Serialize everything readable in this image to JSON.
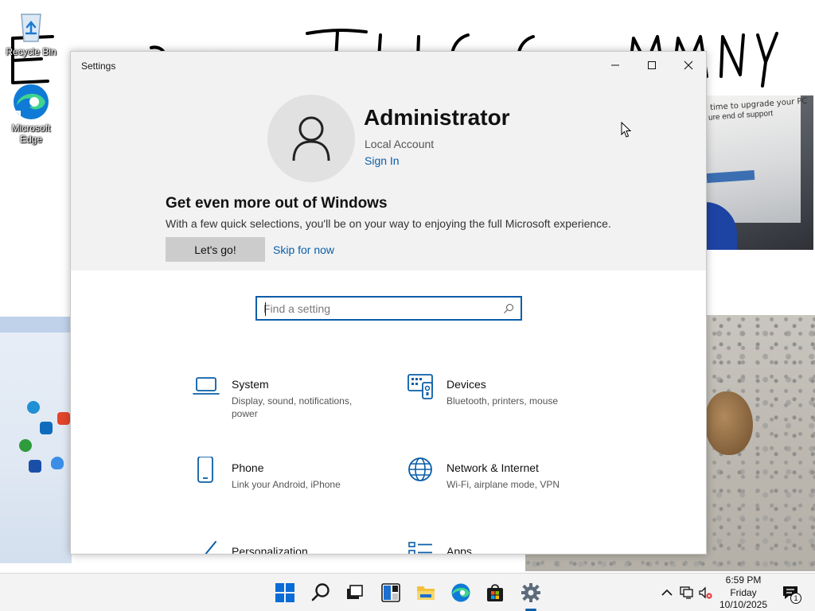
{
  "desktop": {
    "icons": [
      {
        "label": "Recycle Bin",
        "icon": "recycle-bin-icon"
      },
      {
        "label": "Microsoft Edge",
        "icon": "edge-icon"
      }
    ],
    "monitor_photo_lines": [
      "time to upgrade your PC",
      "ure end of support"
    ]
  },
  "window": {
    "title": "Settings",
    "controls": [
      "minimize",
      "maximize",
      "close"
    ]
  },
  "profile": {
    "name": "Administrator",
    "account_type": "Local Account",
    "sign_in": "Sign In",
    "avatar_icon": "user-avatar-icon"
  },
  "promo": {
    "title": "Get even more out of Windows",
    "text": "With a few quick selections, you'll be on your way to enjoying the full Microsoft experience.",
    "primary_button": "Let's go!",
    "secondary_link": "Skip for now"
  },
  "search": {
    "placeholder": "Find a setting",
    "value": ""
  },
  "categories": [
    {
      "name": "System",
      "description": "Display, sound, notifications, power",
      "icon": "laptop-icon"
    },
    {
      "name": "Devices",
      "description": "Bluetooth, printers, mouse",
      "icon": "keyboard-devices-icon"
    },
    {
      "name": "Phone",
      "description": "Link your Android, iPhone",
      "icon": "phone-icon"
    },
    {
      "name": "Network & Internet",
      "description": "Wi-Fi, airplane mode, VPN",
      "icon": "globe-icon"
    },
    {
      "name": "Personalization",
      "description": "",
      "icon": "paint-brush-icon"
    },
    {
      "name": "Apps",
      "description": "",
      "icon": "apps-list-icon"
    }
  ],
  "taskbar": {
    "apps": [
      "start",
      "search",
      "task-view",
      "widgets",
      "file-explorer",
      "edge",
      "store",
      "settings"
    ],
    "active_app": "settings",
    "clock": {
      "time": "6:59 PM",
      "day": "Friday",
      "date": "10/10/2025"
    },
    "notification_count": "1"
  },
  "colors": {
    "accent": "#0a5ea8",
    "window_header_bg": "#f2f2f2",
    "taskbar_bg": "#f3f3f3"
  }
}
